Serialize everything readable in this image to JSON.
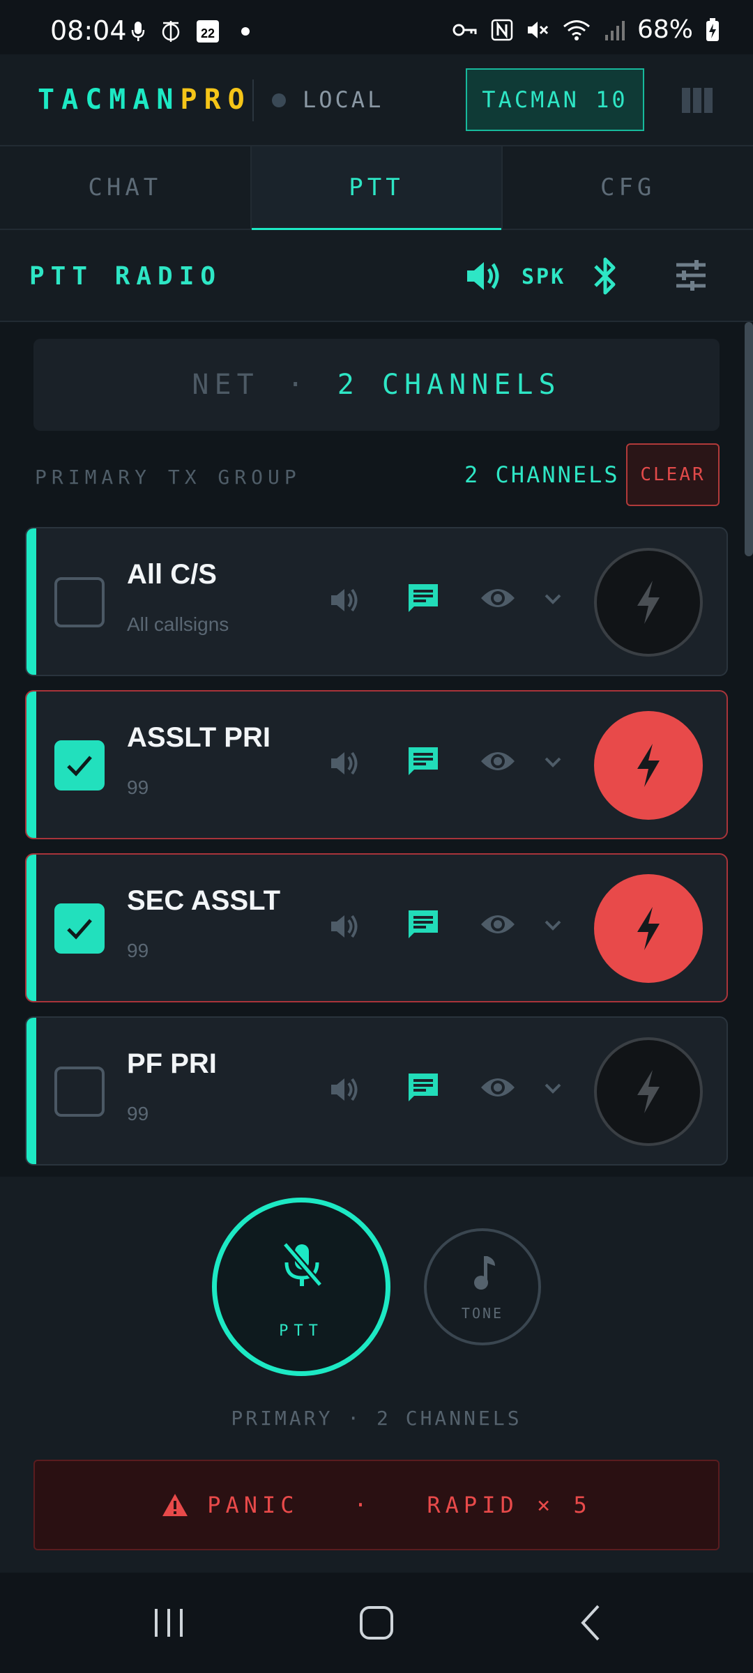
{
  "status_bar": {
    "time": "08:04",
    "battery": "68%",
    "calendar_day": "22"
  },
  "app": {
    "brand_part1": "TACMAN",
    "brand_part2": "PRO",
    "mode": "LOCAL",
    "node": "TACMAN 10",
    "colors": {
      "accent": "#1de9c4",
      "brand_yellow": "#f5c518",
      "alert": "#e84a4a"
    }
  },
  "tabs": [
    {
      "label": "CHAT",
      "active": false
    },
    {
      "label": "PTT",
      "active": true
    },
    {
      "label": "CFG",
      "active": false
    }
  ],
  "section": {
    "title": "PTT RADIO",
    "speaker_label": "SPK"
  },
  "net": {
    "key": "NET",
    "separator": "·",
    "value": "2 CHANNELS"
  },
  "group": {
    "label": "PRIMARY TX GROUP",
    "count": "2 CHANNELS",
    "clear_label": "CLEAR"
  },
  "channels": [
    {
      "name": "All C/S",
      "sub": "All callsigns",
      "selected": false
    },
    {
      "name": "ASSLT PRI",
      "sub": "99",
      "selected": true
    },
    {
      "name": "SEC ASSLT",
      "sub": "99",
      "selected": true
    },
    {
      "name": "PF PRI",
      "sub": "99",
      "selected": false
    }
  ],
  "dock": {
    "ptt_label": "PTT",
    "tone_label": "TONE",
    "status": "PRIMARY · 2 CHANNELS",
    "panic_label": "PANIC   ·   RAPID × 5"
  }
}
